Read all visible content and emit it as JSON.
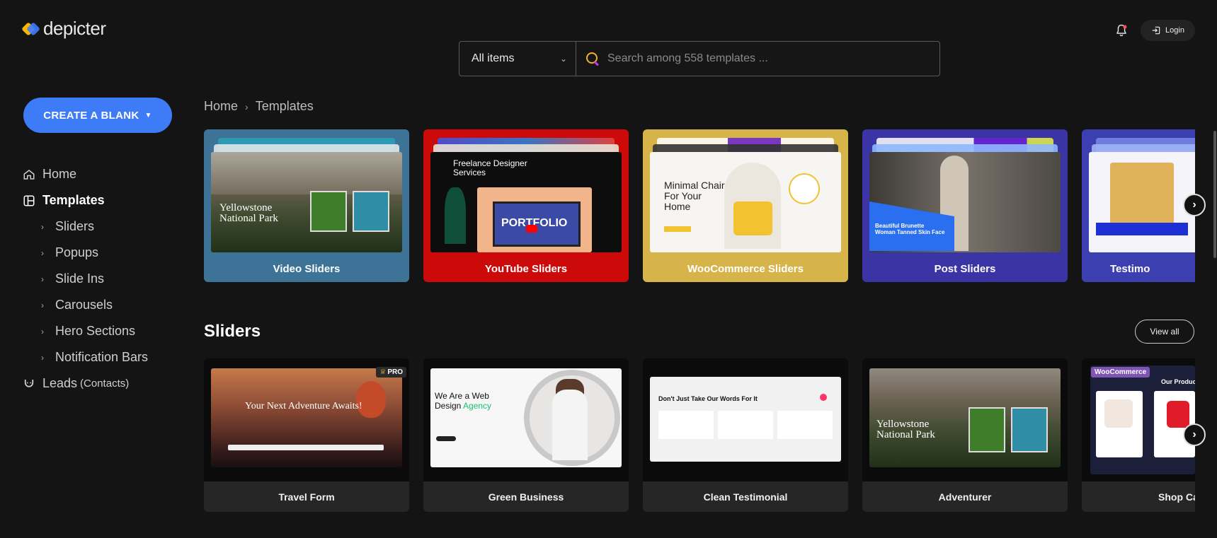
{
  "logo": {
    "text": "depicter"
  },
  "header": {
    "filter_select": "All items",
    "search_placeholder": "Search among 558 templates ...",
    "login_label": "Login"
  },
  "sidebar": {
    "create_label": "CREATE A BLANK",
    "items": [
      {
        "label": "Home",
        "icon": "home-icon"
      },
      {
        "label": "Templates",
        "icon": "templates-icon",
        "active": true
      },
      {
        "label": "Sliders"
      },
      {
        "label": "Popups"
      },
      {
        "label": "Slide Ins"
      },
      {
        "label": "Carousels"
      },
      {
        "label": "Hero Sections"
      },
      {
        "label": "Notification Bars"
      },
      {
        "label": "Leads",
        "suffix": "(Contacts)",
        "icon": "leads-icon"
      }
    ]
  },
  "breadcrumb": {
    "home": "Home",
    "current": "Templates"
  },
  "categories": [
    {
      "label": "Video Sliders",
      "bg": "#3c7396",
      "preview_title": "Yellowstone National Park"
    },
    {
      "label": "YouTube Sliders",
      "bg": "#cc0a0a",
      "preview_title": "Freelance Designer Services",
      "preview_word": "PORTFOLIO"
    },
    {
      "label": "WooCommerce Sliders",
      "bg": "#d6b44a",
      "preview_title": "Minimal Chair For Your Home"
    },
    {
      "label": "Post Sliders",
      "bg": "#3a34a4",
      "preview_title": "Beautiful Brunette Woman Tanned Skin Face"
    },
    {
      "label": "Testimo",
      "bg": "#3c3fb0"
    }
  ],
  "sliders_section": {
    "title": "Sliders",
    "view_all": "View all",
    "templates": [
      {
        "label": "Travel Form",
        "badge": "PRO",
        "preview_title": "Your Next Adventure Awaits!"
      },
      {
        "label": "Green Business",
        "preview_title": "We Are a Web Design",
        "preview_accent": "Agency"
      },
      {
        "label": "Clean Testimonial",
        "preview_title": "Don't Just Take Our Words For It"
      },
      {
        "label": "Adventurer",
        "preview_title": "Yellowstone National Park"
      },
      {
        "label": "Shop Ca",
        "badge": "WooCommerce",
        "preview_title": "Our Produc"
      }
    ]
  }
}
